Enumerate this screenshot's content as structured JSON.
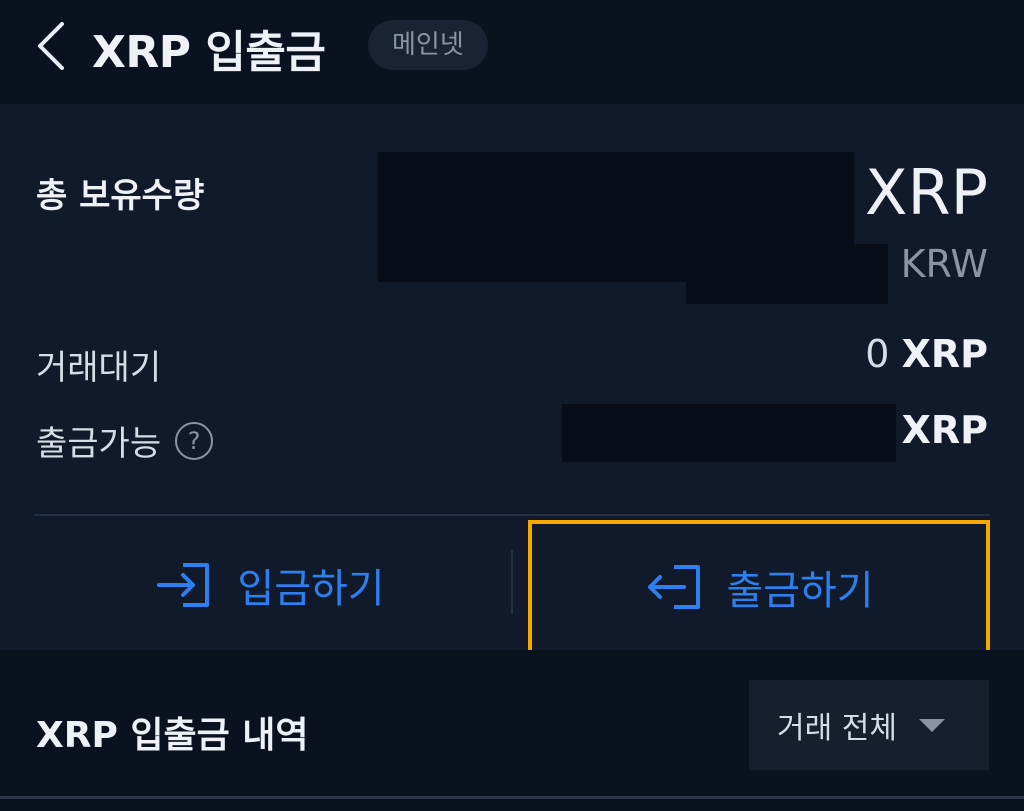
{
  "header": {
    "title": "XRP 입출금",
    "network_badge": "메인넷"
  },
  "balance": {
    "total_label": "총 보유수량",
    "total_unit": "XRP",
    "krw_unit": "KRW",
    "pending_label": "거래대기",
    "pending_amount": "0",
    "pending_unit": "XRP",
    "withdrawable_label": "출금가능",
    "help_glyph": "?",
    "withdrawable_unit": "XRP"
  },
  "actions": {
    "deposit_label": "입금하기",
    "withdraw_label": "출금하기"
  },
  "history": {
    "title": "XRP 입출금 내역",
    "filter_label": "거래 전체"
  },
  "colors": {
    "background": "#0a1220",
    "card": "#101a2a",
    "accent_blue": "#2d7ff0",
    "highlight_orange": "#f7a800",
    "muted_text": "#8a94a3"
  },
  "icons": [
    "back-chevron-icon",
    "help-icon",
    "deposit-icon",
    "withdraw-icon",
    "caret-down-icon"
  ]
}
